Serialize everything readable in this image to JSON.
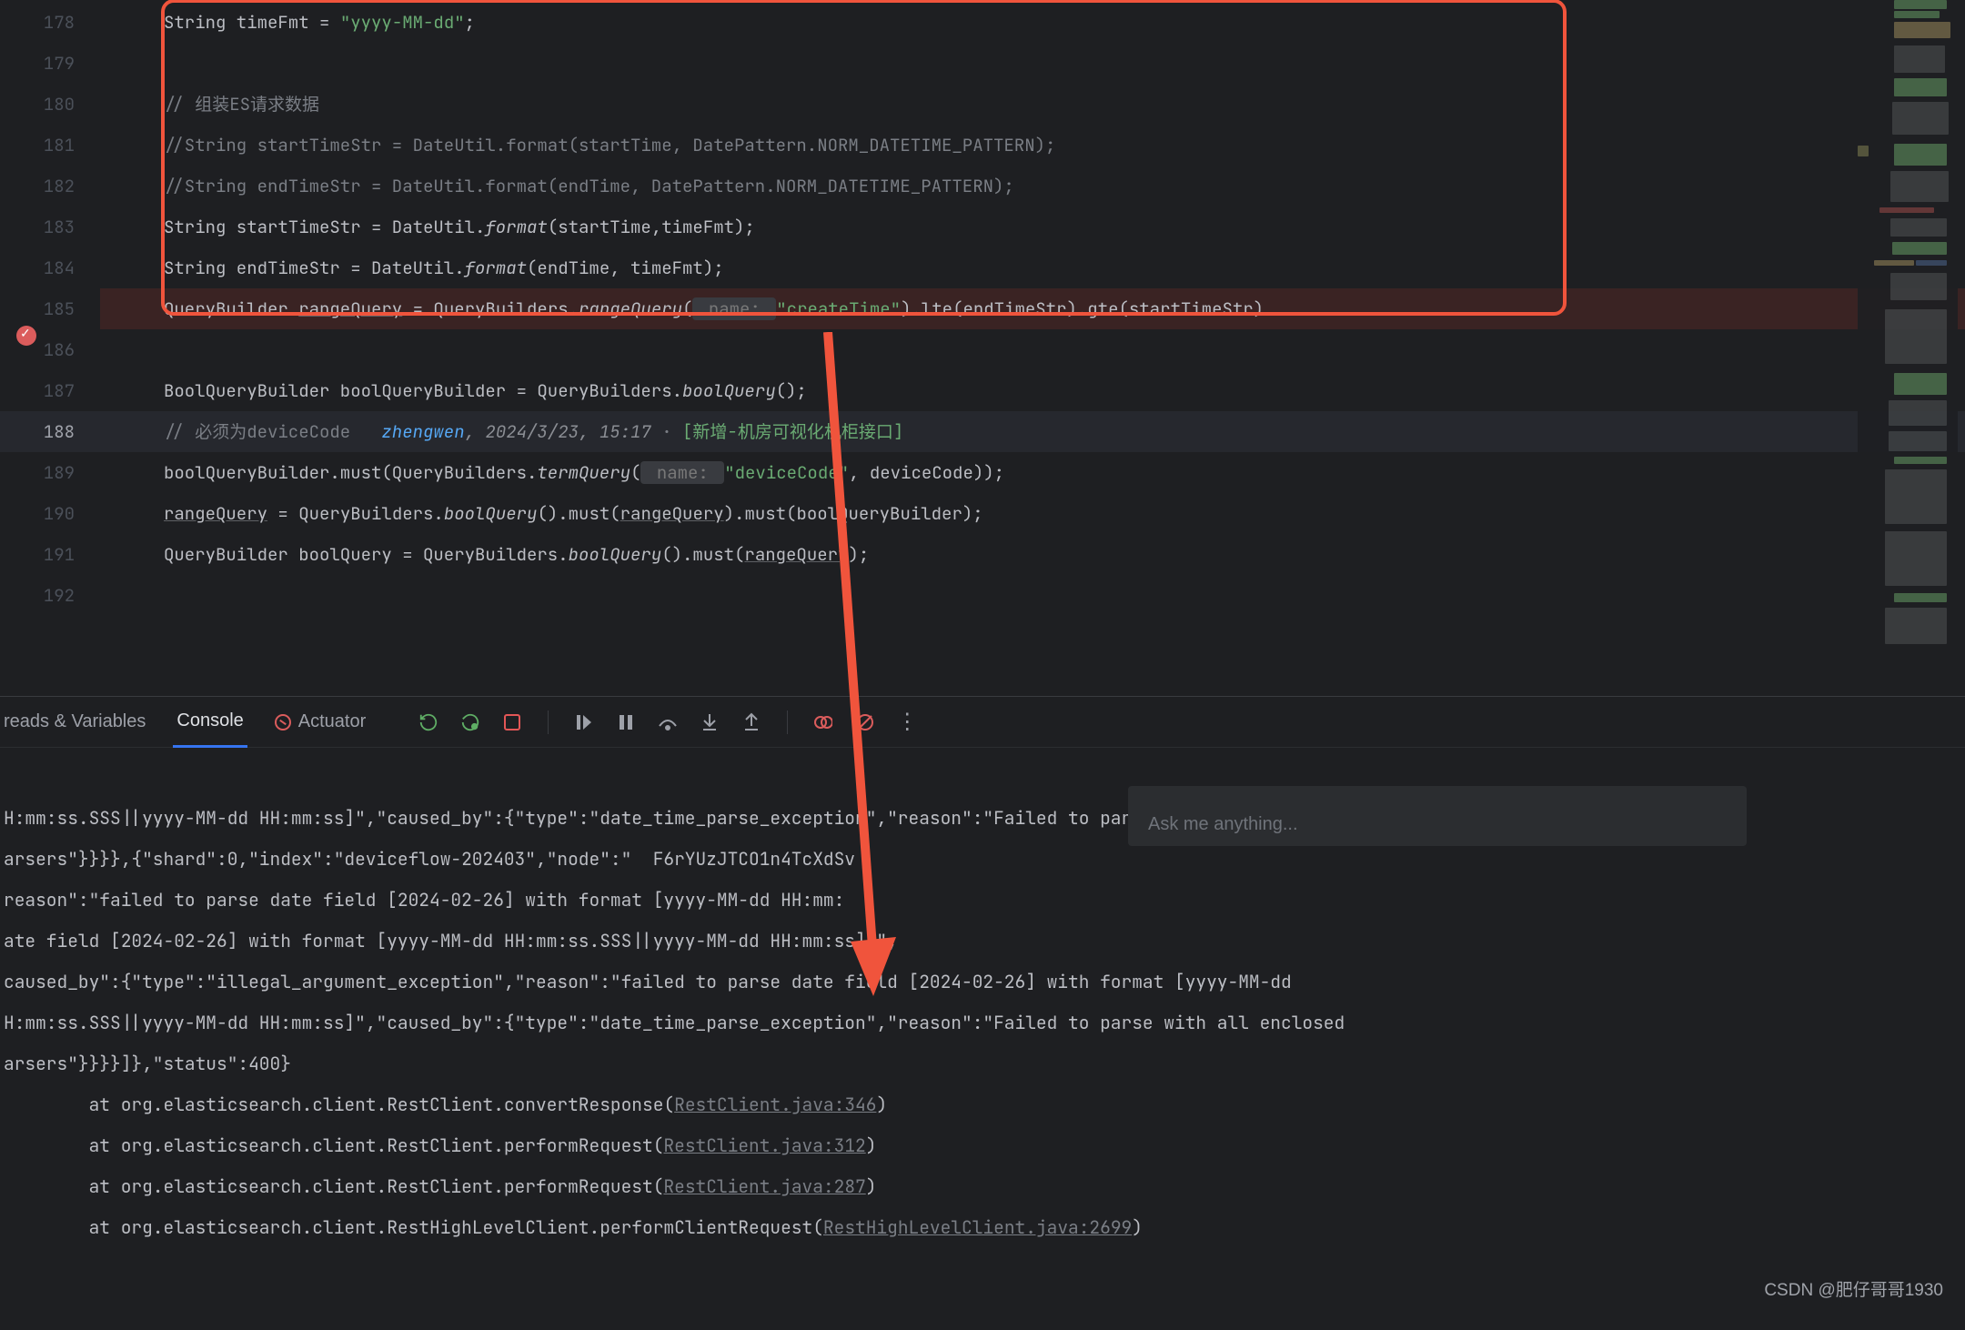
{
  "line_numbers": [
    "178",
    "179",
    "180",
    "181",
    "182",
    "183",
    "184",
    "185",
    "186",
    "187",
    "188",
    "189",
    "190",
    "191",
    "192"
  ],
  "current_line": "188",
  "code": {
    "l178_pre": "String timeFmt = ",
    "l178_str": "\"yyyy-MM-dd\"",
    "l178_post": ";",
    "l180_cm": "// 组装ES请求数据",
    "l181_cm": "//String startTimeStr = DateUtil.format(startTime, DatePattern.NORM_DATETIME_PATTERN);",
    "l182_cm": "//String endTimeStr = DateUtil.format(endTime, DatePattern.NORM_DATETIME_PATTERN);",
    "l183_a": "String startTimeStr = DateUtil.",
    "l183_fn": "format",
    "l183_b": "(startTime,timeFmt);",
    "l184_a": "String endTimeStr = DateUtil.",
    "l184_fn": "format",
    "l184_b": "(endTime, timeFmt);",
    "l185_a": "QueryBuilder ",
    "l185_rq": "rangeQuery",
    "l185_b": " = QueryBuilders.",
    "l185_fn": "rangeQuery",
    "l185_c": "(",
    "l185_hint": " name: ",
    "l185_str": "\"createTime\"",
    "l185_d": ").lte(endTimeStr).gte(startTimeStr)",
    "l187_a": "BoolQueryBuilder boolQueryBuilder = QueryBuilders.",
    "l187_fn": "boolQuery",
    "l187_b": "();",
    "l188_cm": "// 必须为deviceCode   ",
    "l188_auth": "zhengwen",
    "l188_sep": ", ",
    "l188_date": "2024/3/23, 15:17",
    "l188_dot": " · ",
    "l188_msg": "[新增-机房可视化机柜接口]",
    "l189_a": "boolQueryBuilder.must(QueryBuilders.",
    "l189_fn": "termQuery",
    "l189_b": "(",
    "l189_hint": " name: ",
    "l189_str": "\"deviceCode\"",
    "l189_c": ", deviceCode));",
    "l190_rq": "rangeQuery",
    "l190_a": " = QueryBuilders.",
    "l190_fn": "boolQuery",
    "l190_b": "().must(",
    "l190_rq2": "rangeQuery",
    "l190_c": ").must(boolQueryBuilder);",
    "l191_a": "QueryBuilder boolQuery = QueryBuilders.",
    "l191_fn": "boolQuery",
    "l191_b": "().must(",
    "l191_rq": "rangeQuery",
    "l191_c": ");"
  },
  "tabs": {
    "threads": "reads & Variables",
    "console": "Console",
    "actuator": "Actuator"
  },
  "askbox_placeholder": "Ask me anything...",
  "console_lines": [
    "H:mm:ss.SSS||yyyy-MM-dd HH:mm:ss]\",\"caused_by\":{\"type\":\"date_time_parse_exception\",\"reason\":\"Failed to parse with all enclosed ",
    "arsers\"}}}},{\"shard\":0,\"index\":\"deviceflow-202403\",\"node\":\"  F6rYUzJTCO1n4TcXdSv",
    "reason\":\"failed to parse date field [2024-02-26] with format [yyyy-MM-dd HH:mm:",
    "ate field [2024-02-26] with format [yyyy-MM-dd HH:mm:ss.SSS||yyyy-MM-dd HH:mm:ss]]\",",
    "caused_by\":{\"type\":\"illegal_argument_exception\",\"reason\":\"failed to parse date field [2024-02-26] with format [yyyy-MM-dd ",
    "H:mm:ss.SSS||yyyy-MM-dd HH:mm:ss]\",\"caused_by\":{\"type\":\"date_time_parse_exception\",\"reason\":\"Failed to parse with all enclosed ",
    "arsers\"}}}}]},\"status\":400}"
  ],
  "stack": [
    {
      "pre": "\tat org.elasticsearch.client.RestClient.convertResponse(",
      "link": "RestClient.java:346",
      "post": ")"
    },
    {
      "pre": "\tat org.elasticsearch.client.RestClient.performRequest(",
      "link": "RestClient.java:312",
      "post": ")"
    },
    {
      "pre": "\tat org.elasticsearch.client.RestClient.performRequest(",
      "link": "RestClient.java:287",
      "post": ")"
    },
    {
      "pre": "\tat org.elasticsearch.client.RestHighLevelClient.performClientRequest(",
      "link": "RestHighLevelClient.java:2699",
      "post": ")"
    }
  ],
  "watermark": "CSDN @肥仔哥哥1930"
}
